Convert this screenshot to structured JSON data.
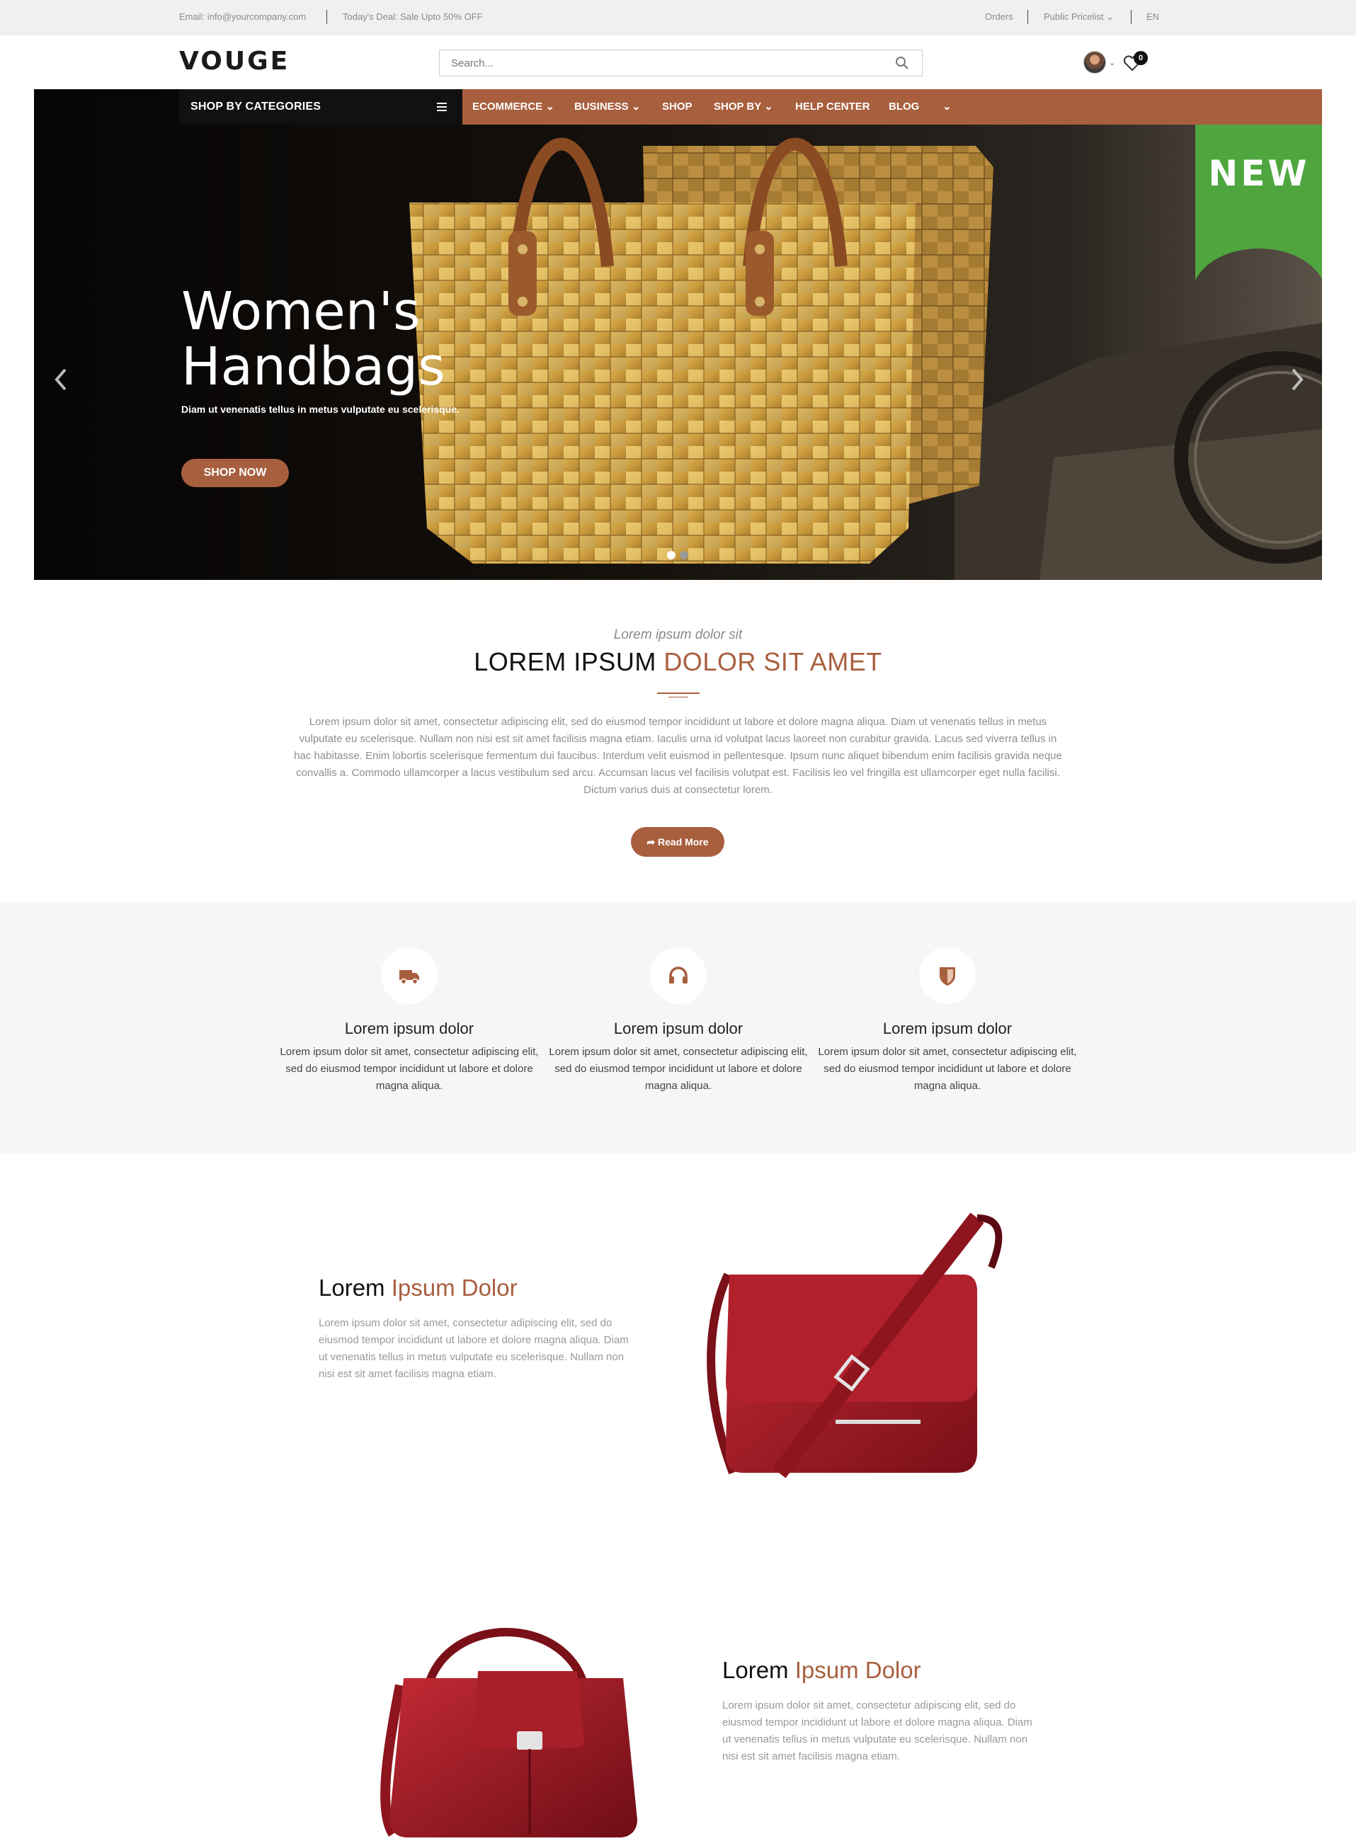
{
  "topbar": {
    "email": "Email:  info@yourcompany.com",
    "deal": "Today's Deal:  Sale Upto 50% OFF",
    "orders": "Orders",
    "pricelist": "Public Pricelist  ⌄",
    "lang": "EN"
  },
  "header": {
    "logo": "VOUGE",
    "search_placeholder": "Search...",
    "cart_count": "0"
  },
  "nav": {
    "categories_label": "SHOP BY CATEGORIES",
    "items": [
      {
        "label": "ECOMMERCE ⌄"
      },
      {
        "label": "BUSINESS ⌄"
      },
      {
        "label": "SHOP"
      },
      {
        "label": "SHOP BY ⌄"
      },
      {
        "label": "HELP CENTER"
      },
      {
        "label": "BLOG"
      },
      {
        "label": "⌄"
      }
    ]
  },
  "hero": {
    "title_line1": "Women's",
    "title_line2": "Handbags",
    "subtitle": "Diam ut venenatis tellus in metus vulputate eu scelerisque.",
    "cta": "SHOP NOW",
    "ribbon": "NEW",
    "slide_count": 2,
    "active_slide": 1
  },
  "intro": {
    "kicker": "Lorem ipsum dolor sit",
    "title_plain": "LOREM IPSUM ",
    "title_accent": "DOLOR SIT AMET",
    "body": "Lorem ipsum dolor sit amet, consectetur adipiscing elit, sed do eiusmod tempor incididunt ut labore et dolore magna aliqua. Diam ut venenatis tellus in metus vulputate eu scelerisque. Nullam non nisi est sit amet facilisis magna etiam. Iaculis urna id volutpat lacus laoreet non curabitur gravida. Lacus sed viverra tellus in hac habitasse. Enim lobortis scelerisque fermentum dui faucibus. Interdum velit euismod in pellentesque. Ipsum nunc aliquet bibendum enim facilisis gravida neque convallis a. Commodo ullamcorper a lacus vestibulum sed arcu. Accumsan lacus vel facilisis volutpat est. Facilisis leo vel fringilla est ullamcorper eget nulla facilisi. Dictum varius duis at consectetur lorem.",
    "button": "Read More"
  },
  "features": [
    {
      "icon": "truck-icon",
      "title": "Lorem ipsum dolor",
      "text": "Lorem ipsum dolor sit amet, consectetur adipiscing elit, sed do eiusmod tempor incididunt ut labore et dolore magna aliqua."
    },
    {
      "icon": "headphones-icon",
      "title": "Lorem ipsum dolor",
      "text": "Lorem ipsum dolor sit amet, consectetur adipiscing elit, sed do eiusmod tempor incididunt ut labore et dolore magna aliqua."
    },
    {
      "icon": "shield-icon",
      "title": "Lorem ipsum dolor",
      "text": "Lorem ipsum dolor sit amet, consectetur adipiscing elit, sed do eiusmod tempor incididunt ut labore et dolore magna aliqua."
    }
  ],
  "products": [
    {
      "title_plain": "Lorem ",
      "title_accent": "Ipsum Dolor",
      "text": "Lorem ipsum dolor sit amet, consectetur adipiscing elit, sed do eiusmod tempor incididunt ut labore et dolore magna aliqua. Diam ut venenatis tellus in metus vulputate eu scelerisque. Nullam non nisi est sit amet facilisis magna etiam."
    },
    {
      "title_plain": "Lorem ",
      "title_accent": "Ipsum Dolor",
      "text": "Lorem ipsum dolor sit amet, consectetur adipiscing elit, sed do eiusmod tempor incididunt ut labore et dolore magna aliqua. Diam ut venenatis tellus in metus vulputate eu scelerisque. Nullam non nisi est sit amet facilisis magna etiam."
    }
  ],
  "colors": {
    "accent": "#a85f3e",
    "ribbon": "#4fa63f",
    "dark": "#111111",
    "topbar_bg": "#f0f0f0",
    "features_bg": "#f6f6f6"
  }
}
